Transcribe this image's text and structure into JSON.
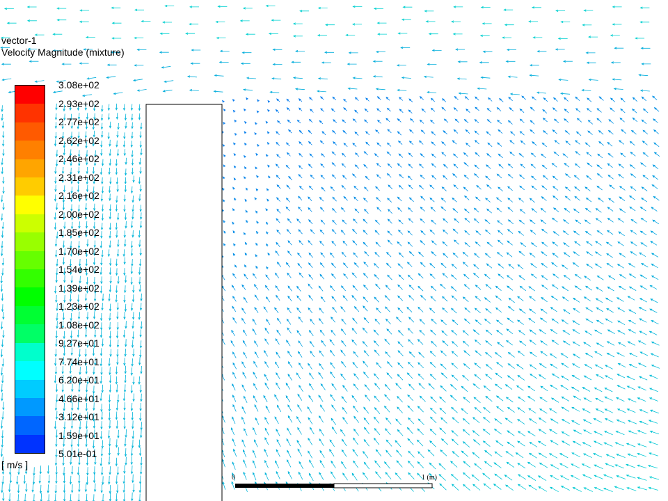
{
  "legend": {
    "name": "vector-1",
    "variable": "Velocity Magnitude (mixture)",
    "units": "[ m/s ]",
    "tick_labels": [
      "3.08e+02",
      "2.93e+02",
      "2.77e+02",
      "2.62e+02",
      "2.46e+02",
      "2.31e+02",
      "2.16e+02",
      "2.00e+02",
      "1.85e+02",
      "1.70e+02",
      "1.54e+02",
      "1.39e+02",
      "1.23e+02",
      "1.08e+02",
      "9.27e+01",
      "7.74e+01",
      "6.20e+01",
      "4.66e+01",
      "3.12e+01",
      "1.59e+01",
      "5.01e-01"
    ],
    "band_colors": [
      "#ff0000",
      "#ff3300",
      "#ff5a00",
      "#ff8000",
      "#ffa500",
      "#ffcc00",
      "#ffff00",
      "#ccff00",
      "#99ff00",
      "#66ff00",
      "#33ff00",
      "#00ff00",
      "#00ff33",
      "#00ff66",
      "#00ffcc",
      "#00ffff",
      "#00ccff",
      "#0099ff",
      "#0066ff",
      "#0033ff"
    ]
  },
  "scale_bar": {
    "start_label": "0",
    "end_label": "1 (m)"
  },
  "colors": {
    "vector_primary": "#00cccc",
    "vector_slow": "#0044ff",
    "body_outline": "#000000"
  }
}
